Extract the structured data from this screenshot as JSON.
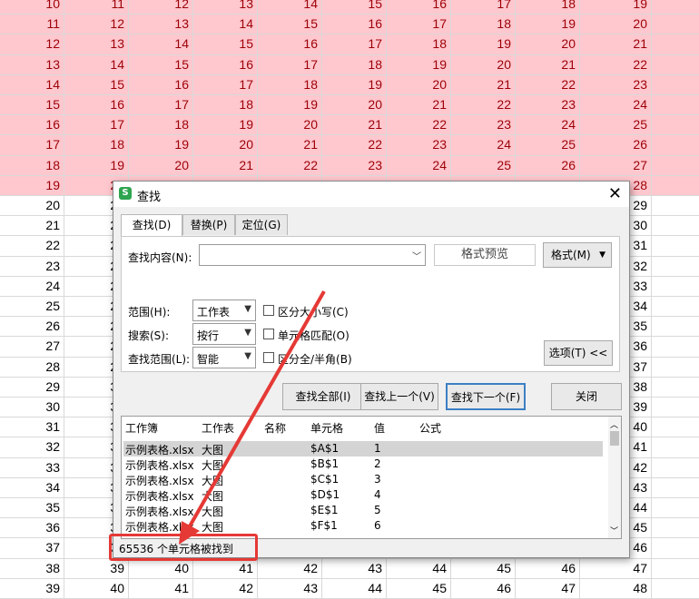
{
  "colors": {
    "highlight_fill": "#ffc7ce",
    "highlight_text": "#9c0006",
    "annotation": "#e53935"
  },
  "sheet": {
    "columns": 10,
    "first_value": 10,
    "highlight_rule": "cells below the diagonal are highlighted pink"
  },
  "dialog": {
    "title": "查找",
    "close_icon": "close-icon",
    "tabs": [
      "查找(D)",
      "替换(P)",
      "定位(G)"
    ],
    "find_label": "查找内容(N):",
    "find_value": "",
    "format_preview": "格式预览",
    "format_button": "格式(M)",
    "scope_label": "范围(H):",
    "scope_value": "工作表",
    "search_label": "搜索(S):",
    "search_value": "按行",
    "lookin_label": "查找范围(L):",
    "lookin_value": "智能",
    "match_case": "区分大小写(C)",
    "match_cell": "单元格匹配(O)",
    "match_width": "区分全/半角(B)",
    "options_button": "选项(T) <<",
    "find_all": "查找全部(I)",
    "find_prev": "查找上一个(V)",
    "find_next": "查找下一个(F)",
    "close_button": "关闭",
    "columns": [
      "工作簿",
      "工作表",
      "名称",
      "单元格",
      "值",
      "公式"
    ],
    "rows": [
      {
        "book": "示例表格.xlsx",
        "sheet": "大图",
        "cell": "$A$1",
        "value": "1"
      },
      {
        "book": "示例表格.xlsx",
        "sheet": "大图",
        "cell": "$B$1",
        "value": "2"
      },
      {
        "book": "示例表格.xlsx",
        "sheet": "大图",
        "cell": "$C$1",
        "value": "3"
      },
      {
        "book": "示例表格.xlsx",
        "sheet": "大图",
        "cell": "$D$1",
        "value": "4"
      },
      {
        "book": "示例表格.xlsx",
        "sheet": "大图",
        "cell": "$E$1",
        "value": "5"
      },
      {
        "book": "示例表格.xlsx",
        "sheet": "大图",
        "cell": "$F$1",
        "value": "6"
      }
    ],
    "status": "65536 个单元格被找到"
  }
}
